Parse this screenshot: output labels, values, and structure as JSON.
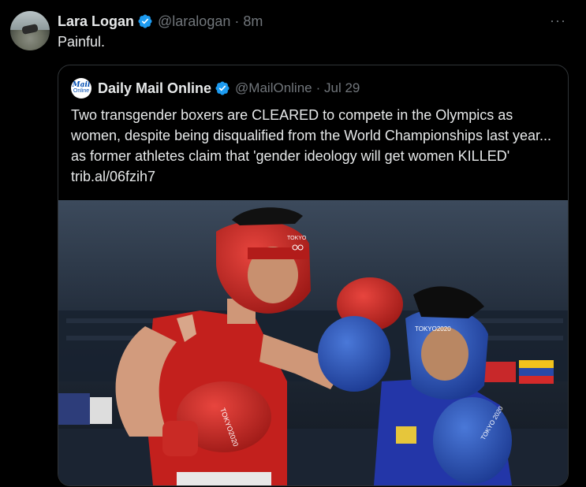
{
  "tweet": {
    "name": "Lara Logan",
    "handle": "@laralogan",
    "time": "· 8m",
    "text": "Painful.",
    "more_icon": "···"
  },
  "quoted": {
    "avatar_line1": "Mail",
    "avatar_line2": "Online",
    "name": "Daily Mail Online",
    "handle": "@MailOnline",
    "time": "· Jul 29",
    "text": "Two transgender boxers are CLEARED to compete in the Olympics as women, despite being disqualified from the World Championships last year... as former athletes claim that 'gender ideology will get women KILLED' trib.al/06fzih7",
    "photo": {
      "headgear_text_left": "TOKYO",
      "headgear_text_right": "TOKYO2020",
      "glove_text_left": "TOKYO2020",
      "glove_text_right": "TOKYO 2020"
    }
  },
  "colors": {
    "background": "#000000",
    "text": "#e7e9ea",
    "muted": "#71767b",
    "verified": "#1d9bf0",
    "border": "#2f3336"
  }
}
